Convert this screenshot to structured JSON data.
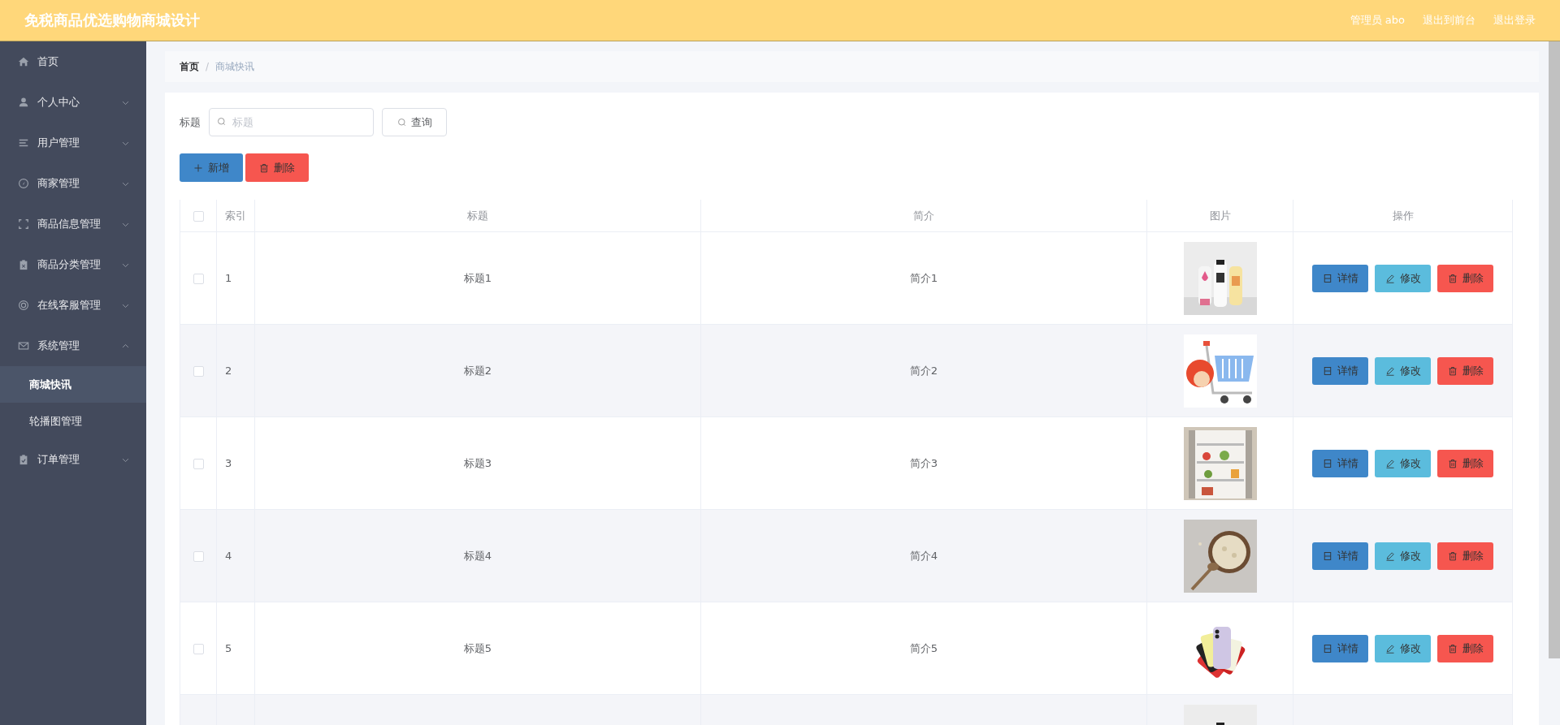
{
  "header": {
    "title": "免税商品优选购物商城设计",
    "links": [
      "管理员 abo",
      "退出到前台",
      "退出登录"
    ]
  },
  "sidebar": {
    "items": [
      {
        "kind": "link",
        "label": "首页"
      },
      {
        "kind": "menu",
        "label": "个人中心",
        "expanded": false
      },
      {
        "kind": "menu",
        "label": "用户管理",
        "expanded": false
      },
      {
        "kind": "menu",
        "label": "商家管理",
        "expanded": false
      },
      {
        "kind": "menu",
        "label": "商品信息管理",
        "expanded": false
      },
      {
        "kind": "menu",
        "label": "商品分类管理",
        "expanded": false
      },
      {
        "kind": "menu",
        "label": "在线客服管理",
        "expanded": false
      },
      {
        "kind": "menu",
        "label": "系统管理",
        "expanded": true,
        "children": [
          {
            "label": "商城快讯",
            "selected": true
          },
          {
            "label": "轮播图管理",
            "selected": false
          }
        ]
      },
      {
        "kind": "menu",
        "label": "订单管理",
        "expanded": false
      }
    ]
  },
  "breadcrumb": {
    "items": [
      "首页",
      "商城快讯"
    ],
    "separator": "/"
  },
  "search": {
    "label": "标题",
    "placeholder": "标题",
    "button": "查询"
  },
  "actions": [
    {
      "kind": "add",
      "label": "新增"
    },
    {
      "kind": "delete",
      "label": "删除"
    }
  ],
  "table": {
    "header_checked": false,
    "columns": [
      "索引",
      "标题",
      "简介",
      "图片",
      "操作"
    ],
    "rows": [
      {
        "checked": false,
        "index": "1",
        "title": "标题1",
        "intro": "简介1",
        "picture": {
          "kind": "picture"
        },
        "buttons": [
          {
            "kind": "detail",
            "label": "详情"
          },
          {
            "kind": "edit",
            "label": "修改"
          },
          {
            "kind": "delete",
            "label": "删除"
          }
        ]
      },
      {
        "checked": false,
        "index": "2",
        "title": "标题2",
        "intro": "简介2",
        "picture": {
          "kind": "picture"
        },
        "buttons": [
          {
            "kind": "detail",
            "label": "详情"
          },
          {
            "kind": "edit",
            "label": "修改"
          },
          {
            "kind": "delete",
            "label": "删除"
          }
        ]
      },
      {
        "checked": false,
        "index": "3",
        "title": "标题3",
        "intro": "简介3",
        "picture": {
          "kind": "picture"
        },
        "buttons": [
          {
            "kind": "detail",
            "label": "详情"
          },
          {
            "kind": "edit",
            "label": "修改"
          },
          {
            "kind": "delete",
            "label": "删除"
          }
        ]
      },
      {
        "checked": false,
        "index": "4",
        "title": "标题4",
        "intro": "简介4",
        "picture": {
          "kind": "picture"
        },
        "buttons": [
          {
            "kind": "detail",
            "label": "详情"
          },
          {
            "kind": "edit",
            "label": "修改"
          },
          {
            "kind": "delete",
            "label": "删除"
          }
        ]
      },
      {
        "checked": false,
        "index": "5",
        "title": "标题5",
        "intro": "简介5",
        "picture": {
          "kind": "picture"
        },
        "buttons": [
          {
            "kind": "detail",
            "label": "详情"
          },
          {
            "kind": "edit",
            "label": "修改"
          },
          {
            "kind": "delete",
            "label": "删除"
          }
        ]
      },
      {
        "picture": {
          "kind": "picture"
        }
      }
    ]
  }
}
